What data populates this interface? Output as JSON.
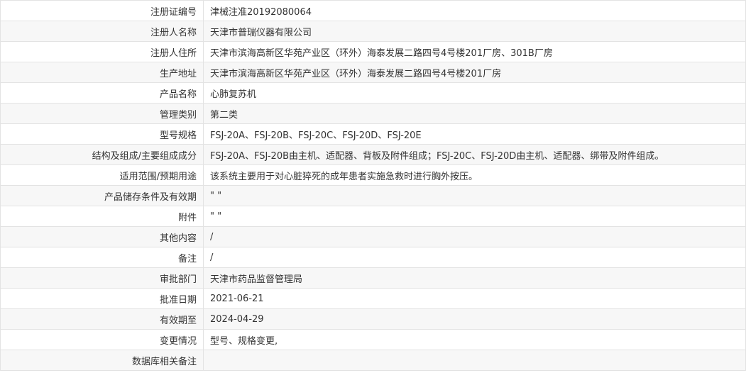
{
  "rows": [
    {
      "label": "注册证编号",
      "value": "津械注准20192080064"
    },
    {
      "label": "注册人名称",
      "value": "天津市普瑞仪器有限公司"
    },
    {
      "label": "注册人住所",
      "value": "天津市滨海高新区华苑产业区（环外）海泰发展二路四号4号楼201厂房、301B厂房"
    },
    {
      "label": "生产地址",
      "value": "天津市滨海高新区华苑产业区（环外）海泰发展二路四号4号楼201厂房"
    },
    {
      "label": "产品名称",
      "value": "心肺复苏机"
    },
    {
      "label": "管理类别",
      "value": "第二类"
    },
    {
      "label": "型号规格",
      "value": "FSJ-20A、FSJ-20B、FSJ-20C、FSJ-20D、FSJ-20E"
    },
    {
      "label": "结构及组成/主要组成成分",
      "value": "FSJ-20A、FSJ-20B由主机、适配器、背板及附件组成；FSJ-20C、FSJ-20D由主机、适配器、绑带及附件组成。"
    },
    {
      "label": "适用范围/预期用途",
      "value": "该系统主要用于对心脏猝死的成年患者实施急救时进行胸外按压。"
    },
    {
      "label": "产品储存条件及有效期",
      "value": "\" \""
    },
    {
      "label": "附件",
      "value": "\" \""
    },
    {
      "label": "其他内容",
      "value": "/"
    },
    {
      "label": "备注",
      "value": "/"
    },
    {
      "label": "审批部门",
      "value": "天津市药品监督管理局"
    },
    {
      "label": "批准日期",
      "value": "2021-06-21"
    },
    {
      "label": "有效期至",
      "value": "2024-04-29"
    },
    {
      "label": "变更情况",
      "value": "型号、规格变更,"
    },
    {
      "label": "数据库相关备注",
      "value": ""
    }
  ]
}
